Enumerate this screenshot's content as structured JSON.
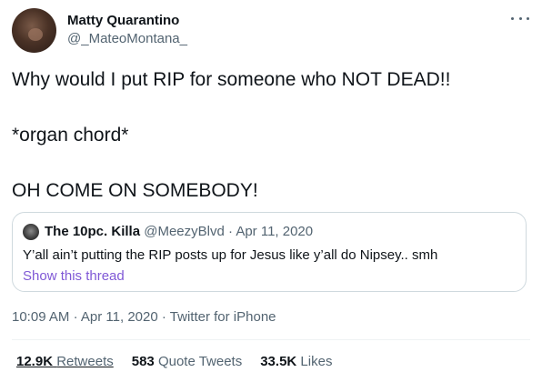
{
  "author": {
    "display_name": "Matty Quarantino",
    "handle": "@_MateoMontana_"
  },
  "tweet": {
    "lines": [
      "Why would I put RIP for someone who NOT DEAD!!",
      "*organ chord*",
      "OH COME ON SOMEBODY!"
    ]
  },
  "quoted_tweet": {
    "display_name": "The 10pc. Killa",
    "handle": "@MeezyBlvd",
    "separator": "·",
    "date": "Apr 11, 2020",
    "text": "Y’all ain’t putting the RIP posts up for Jesus like y’all do Nipsey.. smh",
    "show_thread_label": "Show this thread"
  },
  "meta": {
    "time": "10:09 AM",
    "date": "Apr 11, 2020",
    "separator": "·",
    "source": "Twitter for iPhone"
  },
  "stats": {
    "retweets_count": "12.9K",
    "retweets_label": "Retweets",
    "quote_count": "583",
    "quote_label": "Quote Tweets",
    "likes_count": "33.5K",
    "likes_label": "Likes"
  },
  "icons": {
    "more": "more-horizontal-icon"
  }
}
